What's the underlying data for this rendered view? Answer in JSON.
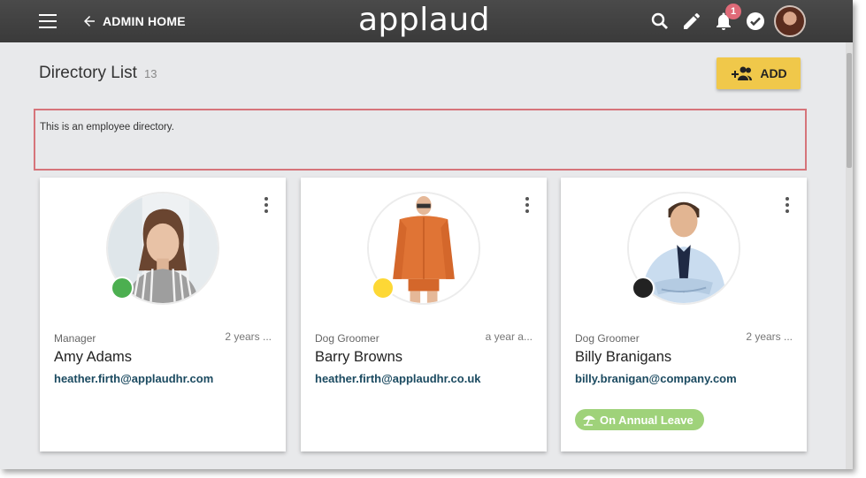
{
  "header": {
    "back_label": "ADMIN HOME",
    "logo_text": "applaud",
    "notification_count": "1"
  },
  "page": {
    "title": "Directory List",
    "count": "13",
    "add_label": "ADD",
    "description": "This is an employee directory."
  },
  "cards": [
    {
      "role": "Manager",
      "time": "2 years ...",
      "name": "Amy Adams",
      "email": "heather.firth@applaudhr.com",
      "status_color": "#4caf50",
      "leave": ""
    },
    {
      "role": "Dog Groomer",
      "time": "a year a...",
      "name": "Barry Browns",
      "email": "heather.firth@applaudhr.co.uk",
      "status_color": "#fdd835",
      "leave": ""
    },
    {
      "role": "Dog Groomer",
      "time": "2 years ...",
      "name": "Billy Branigans",
      "email": "billy.branigan@company.com",
      "status_color": "#222222",
      "leave": "On Annual Leave"
    }
  ],
  "colors": {
    "topbar": "#3f3f3f",
    "add_button": "#f0c84a",
    "email": "#1b4a60",
    "leave_badge": "#9fd27a",
    "description_border": "#d6747a"
  }
}
